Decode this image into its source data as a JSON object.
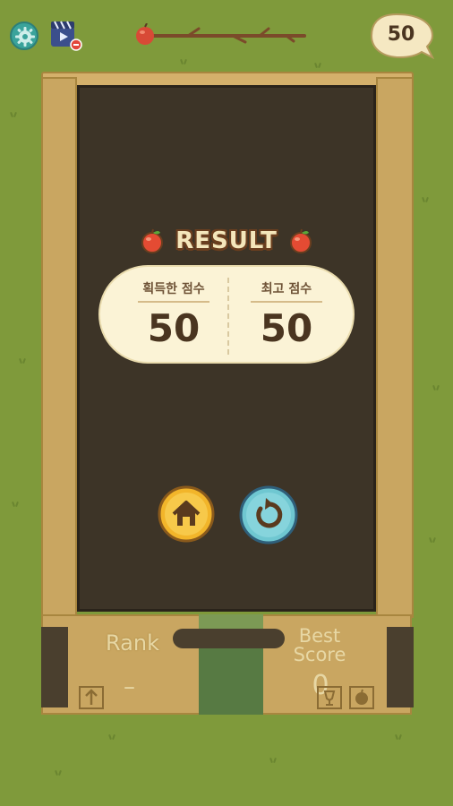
{
  "header": {
    "settings_icon": "gear-icon",
    "video_icon": "video-ad-icon",
    "progress_icon": "apple-branch-timer",
    "score_bubble": "50"
  },
  "result": {
    "title": "RESULT",
    "earned_label": "획득한 점수",
    "earned_value": "50",
    "best_label": "최고 점수",
    "best_value": "50"
  },
  "buttons": {
    "home_icon": "home-icon",
    "retry_icon": "retry-icon"
  },
  "box_front": {
    "rank_label": "Rank",
    "rank_value": "–",
    "best_score_label_line1": "Best",
    "best_score_label_line2": "Score",
    "best_score_value": "0"
  },
  "colors": {
    "grass": "#7f9a3b",
    "board": "#3d3427",
    "card": "#fbf3d6",
    "box": "#c9a661",
    "tape": "#577a43",
    "home_button": "#f2b52a",
    "retry_button": "#6fc7d1"
  }
}
